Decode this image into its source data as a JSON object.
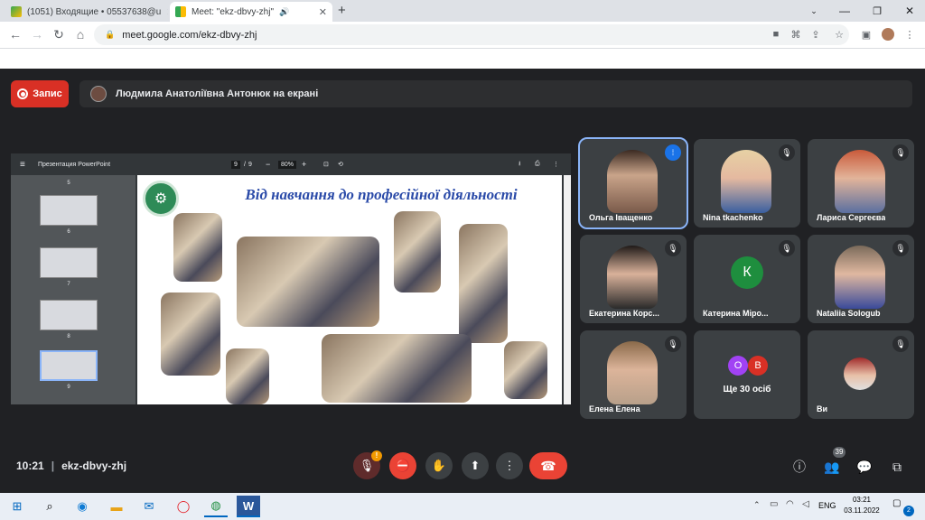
{
  "browser": {
    "tabs": [
      {
        "title": "(1051) Входящие • 05537638@u"
      },
      {
        "title": "Meet: \"ekz-dbvy-zhj\""
      }
    ],
    "new_tab": "+",
    "url": "meet.google.com/ekz-dbvy-zhj"
  },
  "meet": {
    "record_label": "Запис",
    "presenting_banner": "Людмила Анатоліївна Антонюк на екрані",
    "meeting_time": "10:21",
    "meeting_code": "ekz-dbvy-zhj",
    "people_count": "39",
    "warning_badge": "!",
    "chat_badge": "2"
  },
  "pdf": {
    "doc_title": "Презентация PowerPoint",
    "page_current": "9",
    "page_total": "9",
    "zoom": "80%",
    "thumbnail_pages": [
      "5",
      "6",
      "7",
      "8",
      "9"
    ],
    "selected_page": "9"
  },
  "slide": {
    "title": "Від навчання до професійної діяльності"
  },
  "participants": [
    {
      "name": "Ольга Іващенко",
      "speaking": true
    },
    {
      "name": "Nina tkachenko",
      "muted": true
    },
    {
      "name": "Лариса Сергеєва",
      "muted": true
    },
    {
      "name": "Екатерина Корс...",
      "muted": true
    },
    {
      "name": "Катерина Міро...",
      "muted": true,
      "avatar_letter": "К"
    },
    {
      "name": "Nataliia Sologub",
      "muted": true
    },
    {
      "name": "Елена Елена",
      "muted": true
    },
    {
      "name": "Ще 30 осіб",
      "avatars": [
        "О",
        "В"
      ]
    },
    {
      "name": "Ви",
      "muted": true
    }
  ],
  "taskbar": {
    "lang": "ENG",
    "time": "03:21",
    "date": "03.11.2022",
    "notifications": "2"
  },
  "colors": {
    "meet_bg": "#202124",
    "record_red": "#d93025",
    "speaking_outline": "#8ab4f8",
    "slide_title": "#2a4aa8"
  }
}
